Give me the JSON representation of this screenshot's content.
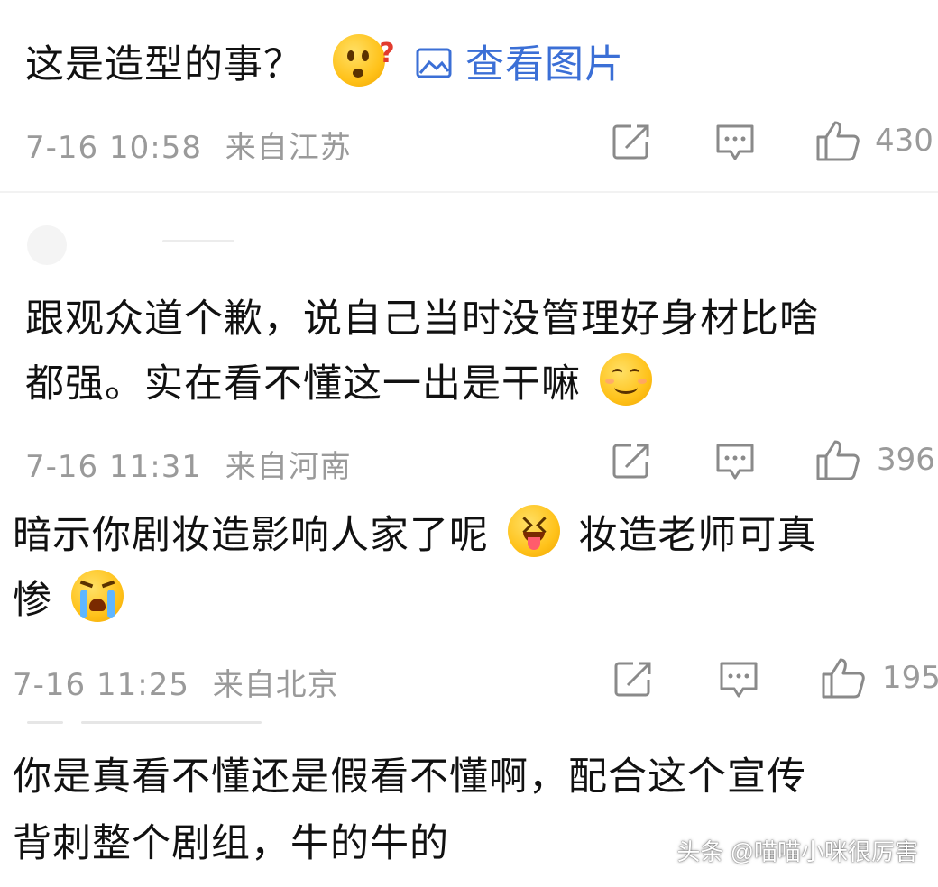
{
  "comments": [
    {
      "text_before": "这是造型的事？",
      "emoji": "question-face-emoji",
      "link_text": "查看图片",
      "time": "7-16 10:58",
      "location": "来自江苏",
      "likes": "430"
    },
    {
      "line1": "跟观众道个歉，说自己当时没管理好身材比啥",
      "line2_text": "都强。实在看不懂这一出是干嘛",
      "emoji": "smile-face-emoji",
      "time": "7-16 11:31",
      "location": "来自河南",
      "likes": "396"
    },
    {
      "line1_a": "暗示你剧妆造影响人家了呢",
      "line1_b": "妆造老师可真",
      "line2": "惨",
      "emoji1": "tongue-face-emoji",
      "emoji2": "crying-face-emoji",
      "time": "7-16 11:25",
      "location": "来自北京",
      "likes": "195"
    },
    {
      "line1": "你是真看不懂还是假看不懂啊，配合这个宣传",
      "line2": "背刺整个剧组，牛的牛的"
    }
  ],
  "icons": {
    "share": "share-icon",
    "comment": "comment-icon",
    "like": "thumbs-up-icon"
  },
  "watermark": "头条 @喵喵小咪很厉害"
}
